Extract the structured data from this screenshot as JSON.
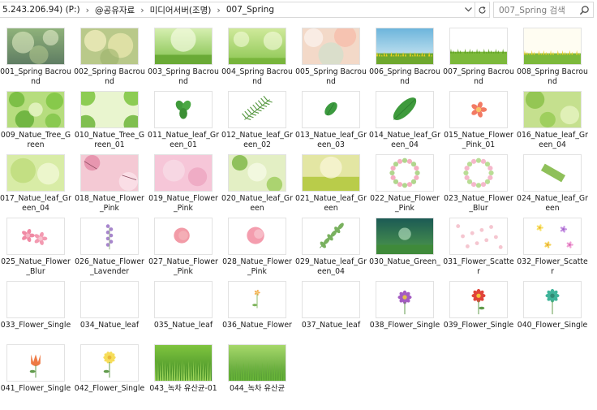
{
  "address_bar": {
    "path": [
      "5.243.206.94) (P:)",
      "@공유자료",
      "미디어서버(조명)",
      "007_Spring"
    ],
    "search_placeholder": "007_Spring 검색"
  },
  "items": [
    {
      "name": "001_Spring Bacround",
      "thumb": "spring-bokeh-dark-green"
    },
    {
      "name": "002_Spring Bacround",
      "thumb": "spring-bokeh-yellow"
    },
    {
      "name": "003_Spring Bacround",
      "thumb": "spring-green-meadow"
    },
    {
      "name": "004_Spring Bacround",
      "thumb": "spring-green-bokeh"
    },
    {
      "name": "005_Spring Bacround",
      "thumb": "spring-pink-bokeh"
    },
    {
      "name": "006_Spring Bacround",
      "thumb": "sky-flower-field"
    },
    {
      "name": "007_Spring Bacround",
      "thumb": "grass-field-light"
    },
    {
      "name": "008_Spring Bacround",
      "thumb": "flower-field-light"
    },
    {
      "name": "009_Natue_Tree_Green",
      "thumb": "tree-green-leaves"
    },
    {
      "name": "010_Natue_Tree_Green_01",
      "thumb": "tree-green-frame"
    },
    {
      "name": "011_Natue_leaf_Green_01",
      "thumb": "clover-leaf"
    },
    {
      "name": "012_Natue_leaf_Green_02",
      "thumb": "fern-leaf"
    },
    {
      "name": "013_Natue_leaf_Green_03",
      "thumb": "small-leaf"
    },
    {
      "name": "014_Natue_leaf_Green_04",
      "thumb": "big-leaf"
    },
    {
      "name": "015_Natue_Flower_Pink_01",
      "thumb": "pink-flower"
    },
    {
      "name": "016_Natue_leaf_Green_04",
      "thumb": "green-bokeh-leaves"
    },
    {
      "name": "017_Natue_leaf_Green_04",
      "thumb": "green-blur"
    },
    {
      "name": "018_Natue_Flower_Pink",
      "thumb": "pink-blossom-blur"
    },
    {
      "name": "019_Natue_Flower_Pink",
      "thumb": "pink-soft-blur"
    },
    {
      "name": "020_Natue_leaf_Green",
      "thumb": "green-leaf-blur"
    },
    {
      "name": "021_Natue_leaf_Green",
      "thumb": "yellow-field-blur"
    },
    {
      "name": "022_Natue_Flower_Pink",
      "thumb": "pink-wreath"
    },
    {
      "name": "023_Natue_Flower_Blur",
      "thumb": "pink-wreath-2"
    },
    {
      "name": "024_Natue_leaf_Green",
      "thumb": "grass-strip"
    },
    {
      "name": "025_Natue_Flower_Blur",
      "thumb": "pink-petals"
    },
    {
      "name": "026_Natue_Flower_Lavender",
      "thumb": "lavender"
    },
    {
      "name": "027_Natue_Flower_Pink",
      "thumb": "pink-rose"
    },
    {
      "name": "028_Natue_Flower_Pink",
      "thumb": "pink-rose-2"
    },
    {
      "name": "029_Natue_leaf_Green_04",
      "thumb": "leaf-branch"
    },
    {
      "name": "030_Natue_Green_",
      "thumb": "dark-forest-glow"
    },
    {
      "name": "031_Flower_Scatter",
      "thumb": "petal-scatter"
    },
    {
      "name": "032_Flower_Scatter",
      "thumb": "flower-scatter"
    },
    {
      "name": "033_Flower_Single",
      "thumb": "blank"
    },
    {
      "name": "034_Natue_leaf",
      "thumb": "blank"
    },
    {
      "name": "035_Natue_leaf",
      "thumb": "blank"
    },
    {
      "name": "036_Natue_Flower",
      "thumb": "tiny-flower"
    },
    {
      "name": "037_Natue_leaf",
      "thumb": "blank"
    },
    {
      "name": "038_Flower_Single",
      "thumb": "purple-daisy"
    },
    {
      "name": "039_Flower_Single",
      "thumb": "red-flower"
    },
    {
      "name": "040_Flower_Single",
      "thumb": "teal-flower"
    },
    {
      "name": "041_Flower_Single",
      "thumb": "orange-tulip"
    },
    {
      "name": "042_Flower_Single",
      "thumb": "yellow-flower"
    },
    {
      "name": "043_녹차 유산균-01",
      "thumb": "green-tea-grass"
    },
    {
      "name": "044_녹차 유산균",
      "thumb": "green-tea-grass-2"
    }
  ]
}
